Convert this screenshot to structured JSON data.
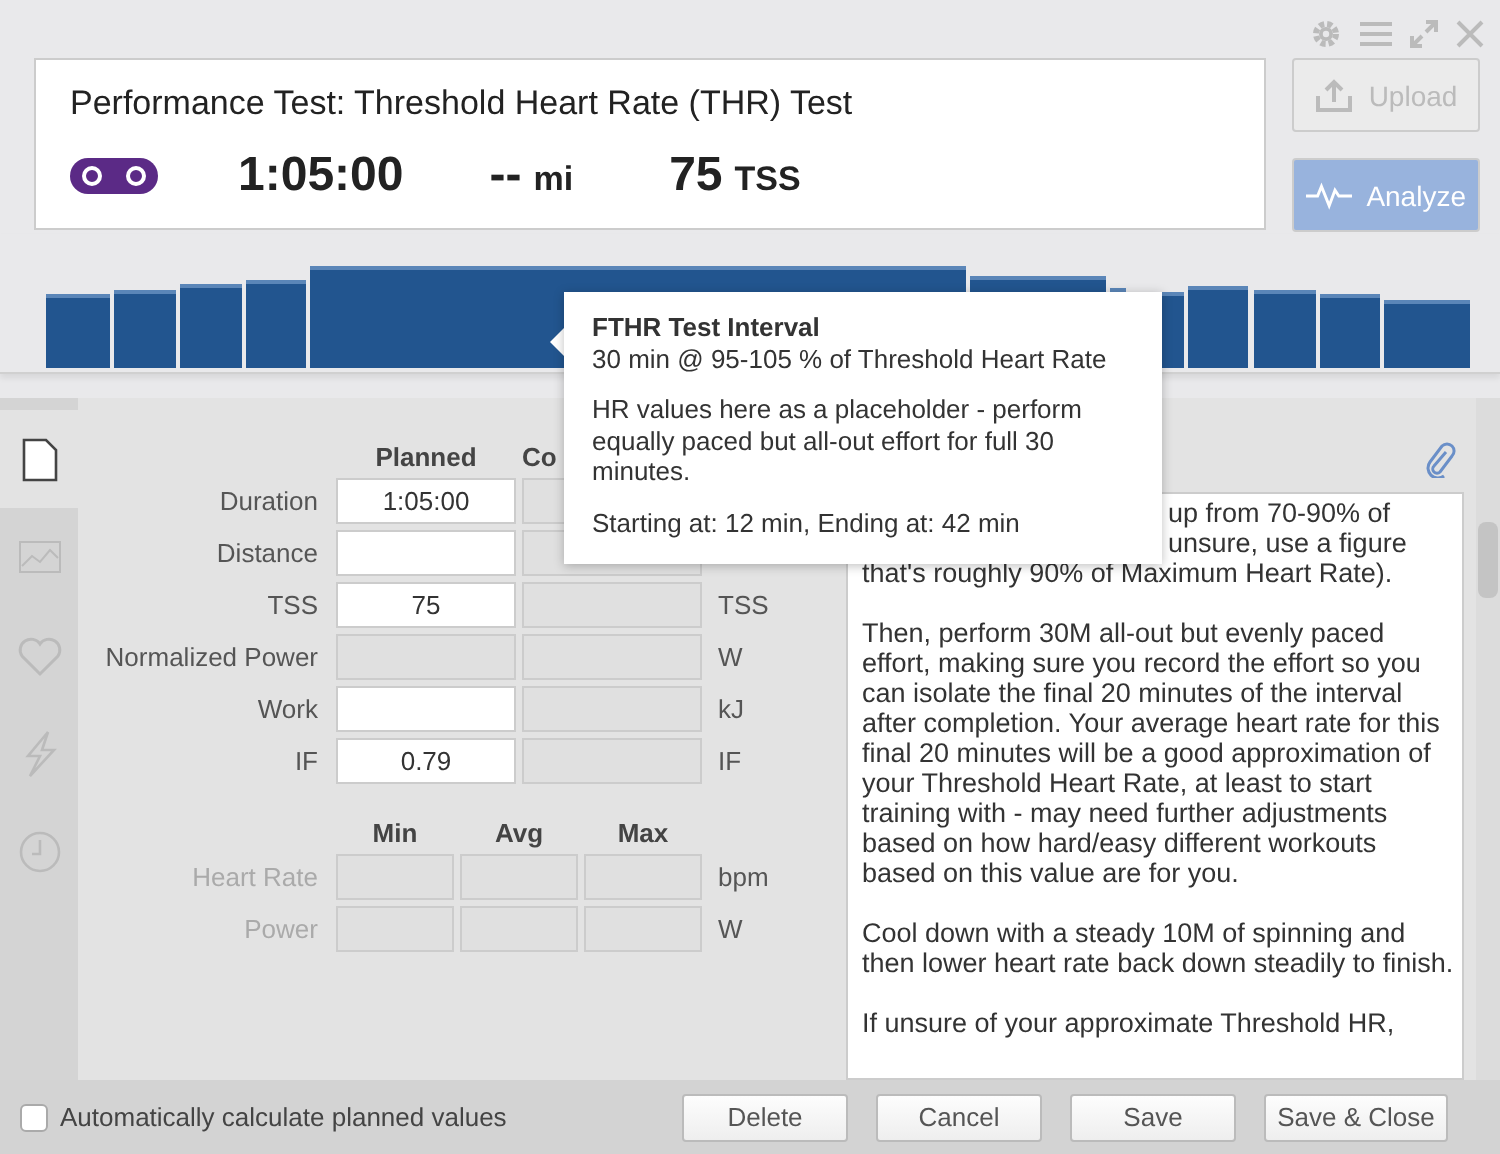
{
  "header": {
    "title": "Performance Test: Threshold Heart Rate (THR) Test",
    "duration": "1:05:00",
    "distance_value": "--",
    "distance_unit": "mi",
    "tss_value": "75",
    "tss_unit": "TSS"
  },
  "actions": [
    {
      "kind": "upload",
      "label": "Upload",
      "disabled": true
    },
    {
      "kind": "analyze",
      "label": "Analyze",
      "disabled": false
    }
  ],
  "tooltip": {
    "title": "FTHR Test Interval",
    "subtitle": "30 min @ 95-105 % of Threshold Heart Rate",
    "note": "HR values here as a placeholder - perform equally paced but all-out effort for full 30 minutes.",
    "timing": "Starting at: 12 min, Ending at: 42 min"
  },
  "sidebar": {
    "items": [
      {
        "kind": "document",
        "selected": true
      },
      {
        "kind": "chart",
        "selected": false
      },
      {
        "kind": "heart",
        "selected": false
      },
      {
        "kind": "lightning",
        "selected": false
      },
      {
        "kind": "clock",
        "selected": false
      }
    ]
  },
  "form": {
    "columns": [
      "Planned",
      "Co"
    ],
    "rows": [
      {
        "label": "Duration",
        "planned": "1:05:00",
        "editable": true,
        "unit": ""
      },
      {
        "label": "Distance",
        "planned": "",
        "editable": true,
        "unit": ""
      },
      {
        "label": "TSS",
        "planned": "75",
        "editable": true,
        "unit": "TSS"
      },
      {
        "label": "Normalized Power",
        "planned": "",
        "editable": false,
        "unit": "W"
      },
      {
        "label": "Work",
        "planned": "",
        "editable": true,
        "unit": "kJ"
      },
      {
        "label": "IF",
        "planned": "0.79",
        "editable": true,
        "unit": "IF"
      }
    ]
  },
  "ranges": {
    "columns": [
      "Min",
      "Avg",
      "Max"
    ],
    "rows": [
      {
        "label": "Heart Rate",
        "unit": "bpm",
        "disabled": true
      },
      {
        "label": "Power",
        "unit": "W",
        "disabled": true
      }
    ]
  },
  "description": {
    "partial_lines": [
      "up from 70-90% of",
      "unsure, use a figure"
    ],
    "paragraphs": [
      "that's roughly 90% of Maximum Heart Rate).",
      "Then, perform 30M all-out but evenly paced effort, making sure you record the effort so you can isolate the final 20 minutes of the interval after completion. Your average heart rate for this final 20 minutes will be a good approximation of your Threshold Heart Rate, at least to start training with - may need further adjustments based on how hard/easy different workouts based on this value are for you.",
      "Cool down with a steady 10M of spinning and then lower heart rate back down steadily to finish.",
      "If unsure of your approximate Threshold HR,"
    ]
  },
  "footer": {
    "checkbox": {
      "label": "Automatically calculate planned values",
      "checked": false
    },
    "buttons": [
      "Delete",
      "Cancel",
      "Save",
      "Save & Close"
    ]
  }
}
